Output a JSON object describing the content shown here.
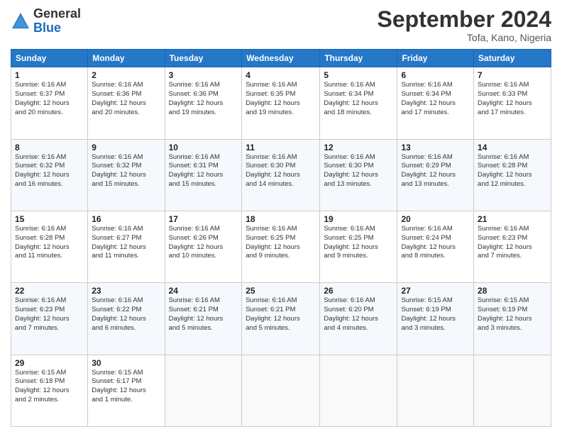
{
  "logo": {
    "general": "General",
    "blue": "Blue"
  },
  "header": {
    "month_title": "September 2024",
    "subtitle": "Tofa, Kano, Nigeria"
  },
  "days_of_week": [
    "Sunday",
    "Monday",
    "Tuesday",
    "Wednesday",
    "Thursday",
    "Friday",
    "Saturday"
  ],
  "weeks": [
    [
      {
        "day": "1",
        "info": "Sunrise: 6:16 AM\nSunset: 6:37 PM\nDaylight: 12 hours\nand 20 minutes."
      },
      {
        "day": "2",
        "info": "Sunrise: 6:16 AM\nSunset: 6:36 PM\nDaylight: 12 hours\nand 20 minutes."
      },
      {
        "day": "3",
        "info": "Sunrise: 6:16 AM\nSunset: 6:36 PM\nDaylight: 12 hours\nand 19 minutes."
      },
      {
        "day": "4",
        "info": "Sunrise: 6:16 AM\nSunset: 6:35 PM\nDaylight: 12 hours\nand 19 minutes."
      },
      {
        "day": "5",
        "info": "Sunrise: 6:16 AM\nSunset: 6:34 PM\nDaylight: 12 hours\nand 18 minutes."
      },
      {
        "day": "6",
        "info": "Sunrise: 6:16 AM\nSunset: 6:34 PM\nDaylight: 12 hours\nand 17 minutes."
      },
      {
        "day": "7",
        "info": "Sunrise: 6:16 AM\nSunset: 6:33 PM\nDaylight: 12 hours\nand 17 minutes."
      }
    ],
    [
      {
        "day": "8",
        "info": "Sunrise: 6:16 AM\nSunset: 6:32 PM\nDaylight: 12 hours\nand 16 minutes."
      },
      {
        "day": "9",
        "info": "Sunrise: 6:16 AM\nSunset: 6:32 PM\nDaylight: 12 hours\nand 15 minutes."
      },
      {
        "day": "10",
        "info": "Sunrise: 6:16 AM\nSunset: 6:31 PM\nDaylight: 12 hours\nand 15 minutes."
      },
      {
        "day": "11",
        "info": "Sunrise: 6:16 AM\nSunset: 6:30 PM\nDaylight: 12 hours\nand 14 minutes."
      },
      {
        "day": "12",
        "info": "Sunrise: 6:16 AM\nSunset: 6:30 PM\nDaylight: 12 hours\nand 13 minutes."
      },
      {
        "day": "13",
        "info": "Sunrise: 6:16 AM\nSunset: 6:29 PM\nDaylight: 12 hours\nand 13 minutes."
      },
      {
        "day": "14",
        "info": "Sunrise: 6:16 AM\nSunset: 6:28 PM\nDaylight: 12 hours\nand 12 minutes."
      }
    ],
    [
      {
        "day": "15",
        "info": "Sunrise: 6:16 AM\nSunset: 6:28 PM\nDaylight: 12 hours\nand 11 minutes."
      },
      {
        "day": "16",
        "info": "Sunrise: 6:16 AM\nSunset: 6:27 PM\nDaylight: 12 hours\nand 11 minutes."
      },
      {
        "day": "17",
        "info": "Sunrise: 6:16 AM\nSunset: 6:26 PM\nDaylight: 12 hours\nand 10 minutes."
      },
      {
        "day": "18",
        "info": "Sunrise: 6:16 AM\nSunset: 6:25 PM\nDaylight: 12 hours\nand 9 minutes."
      },
      {
        "day": "19",
        "info": "Sunrise: 6:16 AM\nSunset: 6:25 PM\nDaylight: 12 hours\nand 9 minutes."
      },
      {
        "day": "20",
        "info": "Sunrise: 6:16 AM\nSunset: 6:24 PM\nDaylight: 12 hours\nand 8 minutes."
      },
      {
        "day": "21",
        "info": "Sunrise: 6:16 AM\nSunset: 6:23 PM\nDaylight: 12 hours\nand 7 minutes."
      }
    ],
    [
      {
        "day": "22",
        "info": "Sunrise: 6:16 AM\nSunset: 6:23 PM\nDaylight: 12 hours\nand 7 minutes."
      },
      {
        "day": "23",
        "info": "Sunrise: 6:16 AM\nSunset: 6:22 PM\nDaylight: 12 hours\nand 6 minutes."
      },
      {
        "day": "24",
        "info": "Sunrise: 6:16 AM\nSunset: 6:21 PM\nDaylight: 12 hours\nand 5 minutes."
      },
      {
        "day": "25",
        "info": "Sunrise: 6:16 AM\nSunset: 6:21 PM\nDaylight: 12 hours\nand 5 minutes."
      },
      {
        "day": "26",
        "info": "Sunrise: 6:16 AM\nSunset: 6:20 PM\nDaylight: 12 hours\nand 4 minutes."
      },
      {
        "day": "27",
        "info": "Sunrise: 6:15 AM\nSunset: 6:19 PM\nDaylight: 12 hours\nand 3 minutes."
      },
      {
        "day": "28",
        "info": "Sunrise: 6:15 AM\nSunset: 6:19 PM\nDaylight: 12 hours\nand 3 minutes."
      }
    ],
    [
      {
        "day": "29",
        "info": "Sunrise: 6:15 AM\nSunset: 6:18 PM\nDaylight: 12 hours\nand 2 minutes."
      },
      {
        "day": "30",
        "info": "Sunrise: 6:15 AM\nSunset: 6:17 PM\nDaylight: 12 hours\nand 1 minute."
      },
      {
        "day": "",
        "info": ""
      },
      {
        "day": "",
        "info": ""
      },
      {
        "day": "",
        "info": ""
      },
      {
        "day": "",
        "info": ""
      },
      {
        "day": "",
        "info": ""
      }
    ]
  ]
}
